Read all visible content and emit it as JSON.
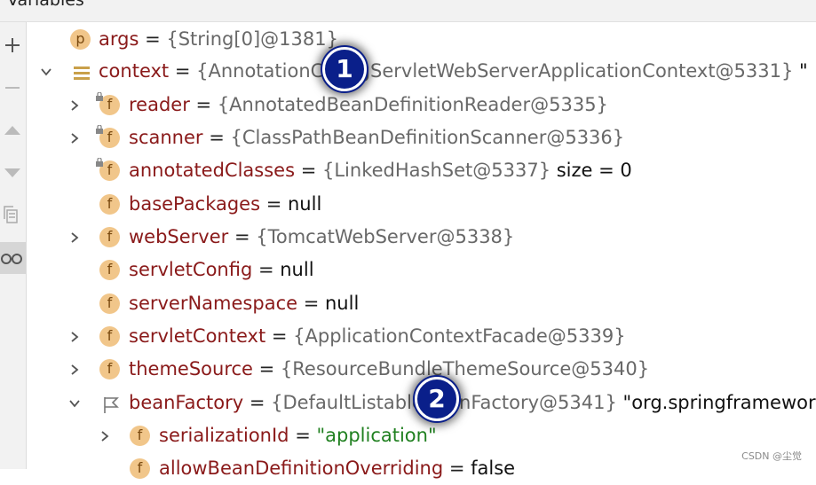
{
  "panel": {
    "title": "Variables"
  },
  "toolbar": {
    "buttons": [
      {
        "name": "add-icon"
      },
      {
        "name": "remove-icon"
      },
      {
        "name": "up-icon"
      },
      {
        "name": "down-icon"
      },
      {
        "name": "copy-icon"
      },
      {
        "name": "glasses-icon"
      }
    ]
  },
  "variables": {
    "args": {
      "icon": "p",
      "name": "args",
      "eq": " = ",
      "value": "{String[0]@1381}"
    },
    "context": {
      "name": "context",
      "eq": " = ",
      "value": "{AnnotationConfigServletWebServerApplicationContext@5331}",
      "extra": " \""
    },
    "reader": {
      "icon": "f",
      "name": "reader",
      "eq": " = ",
      "value": "{AnnotatedBeanDefinitionReader@5335}"
    },
    "scanner": {
      "icon": "f",
      "name": "scanner",
      "eq": " = ",
      "value": "{ClassPathBeanDefinitionScanner@5336}"
    },
    "annotatedClasses": {
      "icon": "f",
      "name": "annotatedClasses",
      "eq": " = ",
      "value": "{LinkedHashSet@5337}",
      "extra": "  size = 0"
    },
    "basePackages": {
      "icon": "f",
      "name": "basePackages",
      "eq": " = ",
      "value": "null"
    },
    "webServer": {
      "icon": "f",
      "name": "webServer",
      "eq": " = ",
      "value": "{TomcatWebServer@5338}"
    },
    "servletConfig": {
      "icon": "f",
      "name": "servletConfig",
      "eq": " = ",
      "value": "null"
    },
    "serverNamespace": {
      "icon": "f",
      "name": "serverNamespace",
      "eq": " = ",
      "value": "null"
    },
    "servletContext": {
      "icon": "f",
      "name": "servletContext",
      "eq": " = ",
      "value": "{ApplicationContextFacade@5339}"
    },
    "themeSource": {
      "icon": "f",
      "name": "themeSource",
      "eq": " = ",
      "value": "{ResourceBundleThemeSource@5340}"
    },
    "beanFactory": {
      "name": "beanFactory",
      "eq": " = ",
      "value": "{DefaultListableBeanFactory@5341}",
      "extra": " \"org.springframewor"
    },
    "serializationId": {
      "icon": "f",
      "name": "serializationId",
      "eq": " = ",
      "value": "\"application\""
    },
    "allowBeanDefinitionOverriding": {
      "icon": "f",
      "name": "allowBeanDefinitionOverriding",
      "eq": " = ",
      "value": "false"
    }
  },
  "annotations": {
    "badge1": "1",
    "badge2": "2"
  },
  "watermark": "CSDN @尘觉",
  "colors": {
    "field_name": "#8a1a1a",
    "object_value": "#686868",
    "string_value": "#208020",
    "icon_fill": "#f1c68a",
    "badge": "#0a1f8a"
  }
}
